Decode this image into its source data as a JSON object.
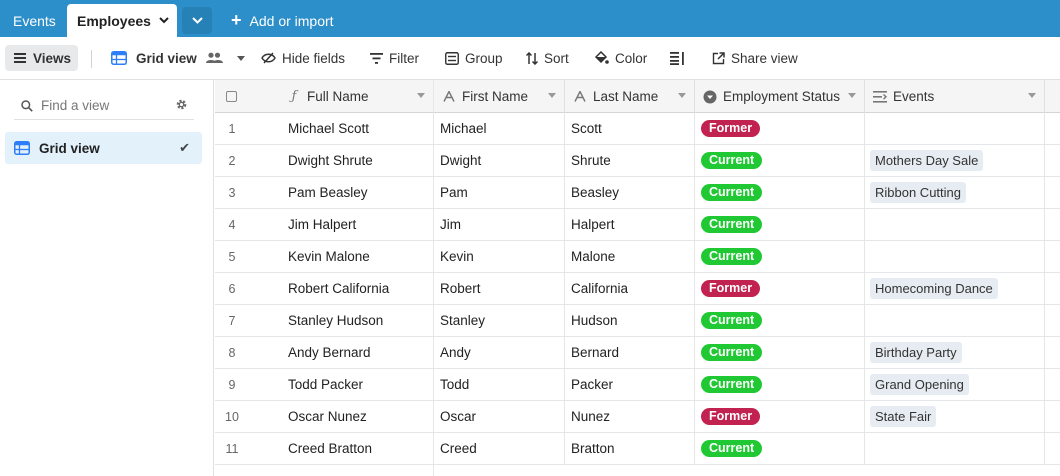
{
  "tabs": {
    "events": "Events",
    "employees": "Employees",
    "add_or_import": "Add or import"
  },
  "toolbar": {
    "views": "Views",
    "grid_view": "Grid view",
    "hide_fields": "Hide fields",
    "filter": "Filter",
    "group": "Group",
    "sort": "Sort",
    "color": "Color",
    "share_view": "Share view"
  },
  "sidebar": {
    "find_placeholder": "Find a view",
    "views": [
      {
        "label": "Grid view"
      }
    ]
  },
  "colors": {
    "accent": "#2d8fc9",
    "former": "#c1224f",
    "current": "#20c933",
    "primary_blue": "#2d7ff9"
  },
  "columns": [
    {
      "label": "Full Name",
      "icon": "formula-icon"
    },
    {
      "label": "First Name",
      "icon": "text-icon"
    },
    {
      "label": "Last Name",
      "icon": "text-icon"
    },
    {
      "label": "Employment Status",
      "icon": "single-select-icon"
    },
    {
      "label": "Events",
      "icon": "linked-record-icon"
    }
  ],
  "rows": [
    {
      "n": "1",
      "full": "Michael Scott",
      "first": "Michael",
      "last": "Scott",
      "status": "Former",
      "event": ""
    },
    {
      "n": "2",
      "full": "Dwight Shrute",
      "first": "Dwight",
      "last": "Shrute",
      "status": "Current",
      "event": "Mothers Day Sale"
    },
    {
      "n": "3",
      "full": "Pam Beasley",
      "first": "Pam",
      "last": "Beasley",
      "status": "Current",
      "event": "Ribbon Cutting"
    },
    {
      "n": "4",
      "full": "Jim Halpert",
      "first": "Jim",
      "last": "Halpert",
      "status": "Current",
      "event": ""
    },
    {
      "n": "5",
      "full": "Kevin Malone",
      "first": "Kevin",
      "last": "Malone",
      "status": "Current",
      "event": ""
    },
    {
      "n": "6",
      "full": "Robert California",
      "first": "Robert",
      "last": "California",
      "status": "Former",
      "event": "Homecoming Dance"
    },
    {
      "n": "7",
      "full": "Stanley Hudson",
      "first": "Stanley",
      "last": "Hudson",
      "status": "Current",
      "event": ""
    },
    {
      "n": "8",
      "full": "Andy Bernard",
      "first": "Andy",
      "last": "Bernard",
      "status": "Current",
      "event": "Birthday Party"
    },
    {
      "n": "9",
      "full": "Todd Packer",
      "first": "Todd",
      "last": "Packer",
      "status": "Current",
      "event": "Grand Opening"
    },
    {
      "n": "10",
      "full": "Oscar Nunez",
      "first": "Oscar",
      "last": "Nunez",
      "status": "Former",
      "event": "State Fair"
    },
    {
      "n": "11",
      "full": "Creed Bratton",
      "first": "Creed",
      "last": "Bratton",
      "status": "Current",
      "event": ""
    }
  ]
}
